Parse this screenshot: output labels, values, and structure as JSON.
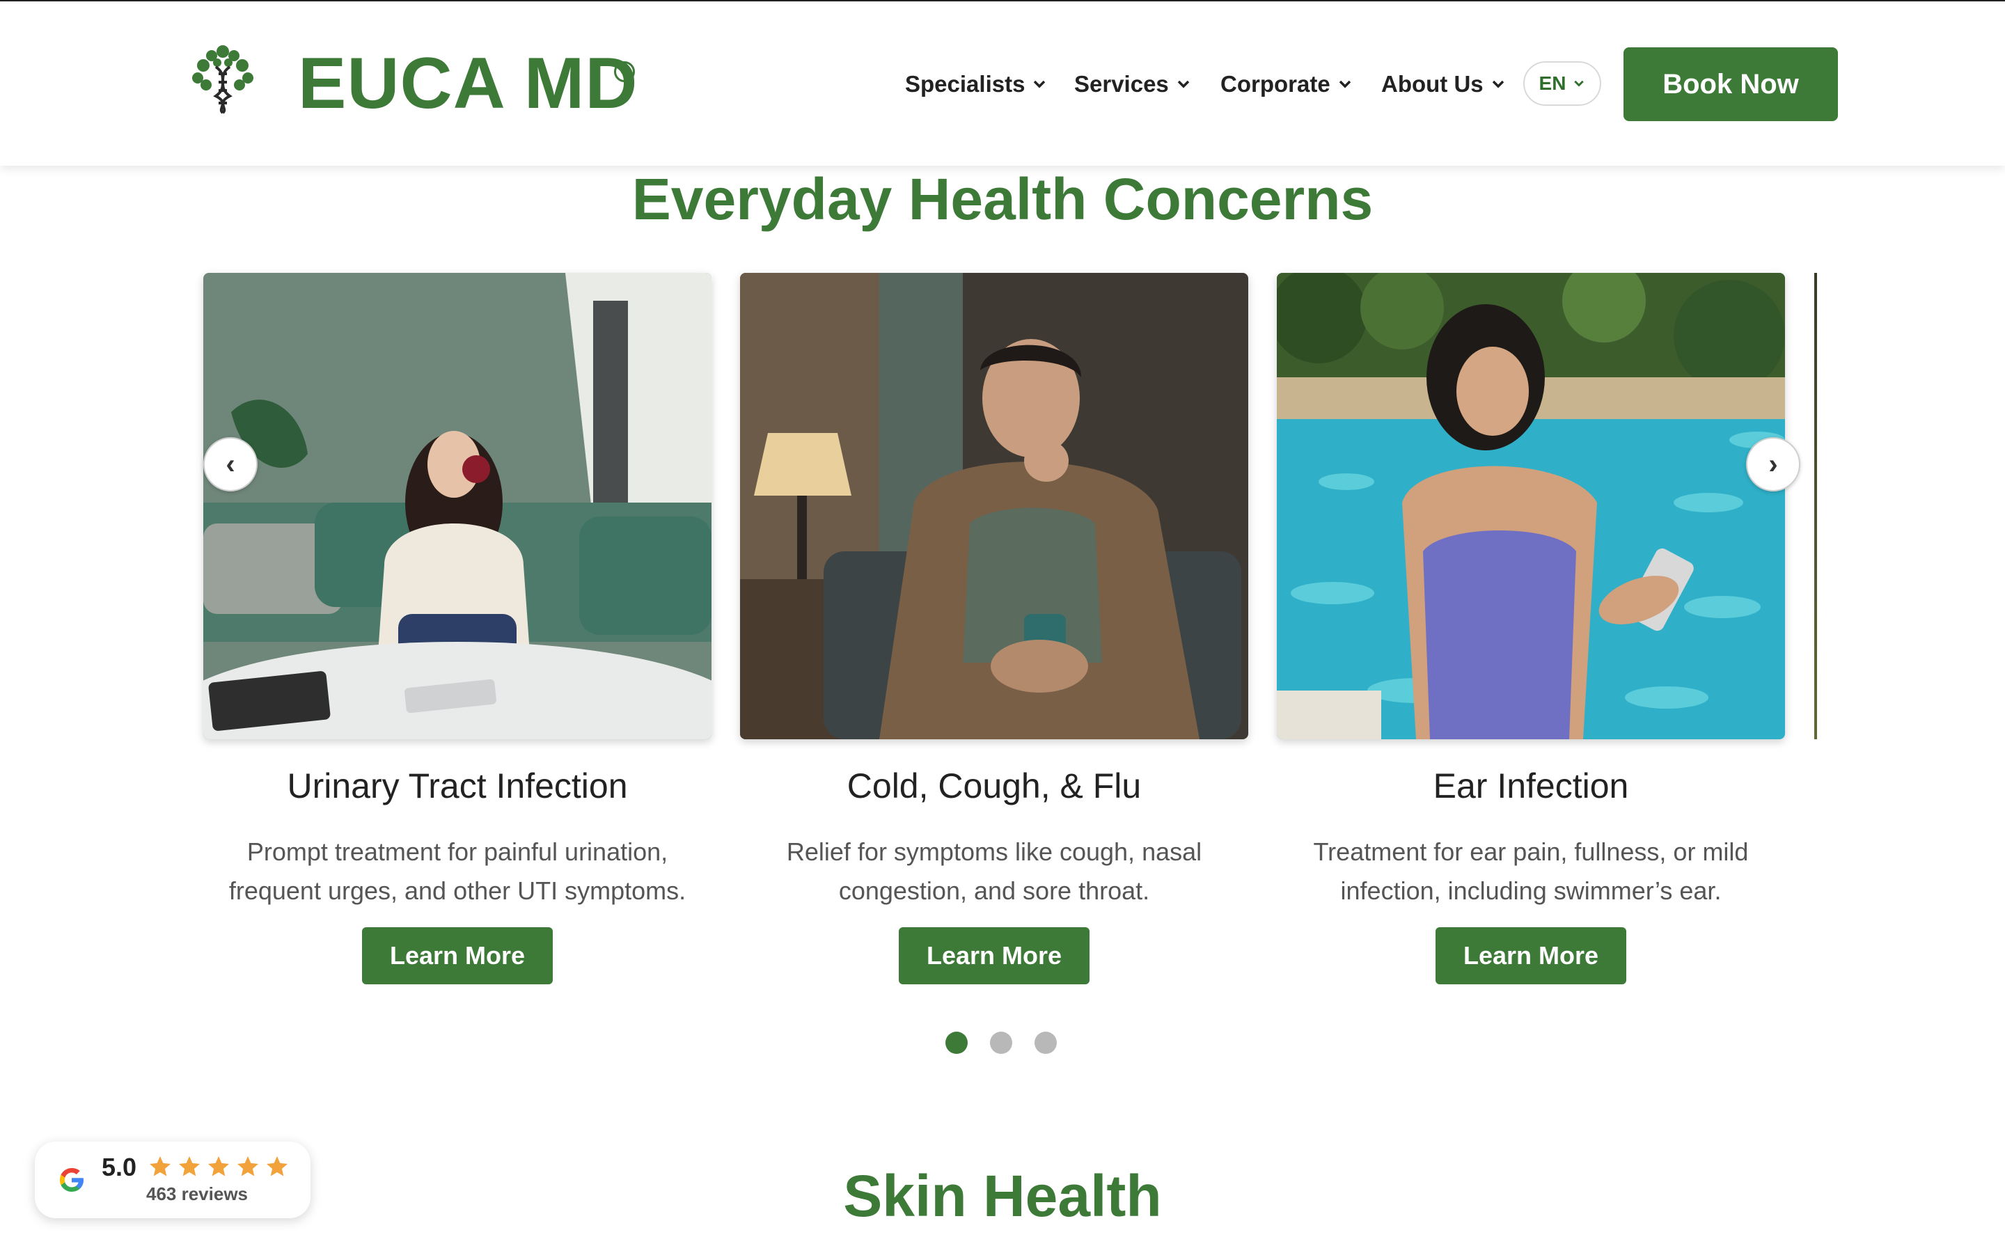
{
  "header": {
    "logo_text": "EUCA MD",
    "logo_registered": "®",
    "nav": [
      {
        "label": "Specialists"
      },
      {
        "label": "Services"
      },
      {
        "label": "Corporate"
      },
      {
        "label": "About Us"
      }
    ],
    "language": "EN",
    "book_label": "Book Now"
  },
  "section_everyday": {
    "title": "Everyday Health Concerns",
    "cards": [
      {
        "title": "Urinary Tract Infection",
        "desc_lines": [
          "Prompt treatment for painful urination,",
          "frequent urges, and other UTI symptoms."
        ],
        "button": "Learn More"
      },
      {
        "title": "Cold, Cough, & Flu",
        "desc_lines": [
          "Relief for symptoms like cough, nasal",
          "congestion, and sore throat."
        ],
        "button": "Learn More"
      },
      {
        "title": "Ear Infection",
        "desc_lines": [
          "Treatment for ear pain, fullness, or mild",
          "infection, including swimmer’s ear."
        ],
        "button": "Learn More"
      }
    ],
    "prev_arrow": "‹",
    "next_arrow": "›",
    "pagination": {
      "count": 3,
      "active": 1
    }
  },
  "section_skin": {
    "title": "Skin Health"
  },
  "review_badge": {
    "rating": "5.0",
    "stars": 5,
    "reviews": "463 reviews"
  },
  "colors": {
    "brand_green": "#3d7a38",
    "star_orange": "#f2a23a",
    "dot_inactive": "#b8b8b8"
  },
  "icons": [
    "dna-tree-logo-icon",
    "chevron-down-icon",
    "arrow-left-icon",
    "arrow-right-icon",
    "google-icon",
    "star-icon"
  ]
}
